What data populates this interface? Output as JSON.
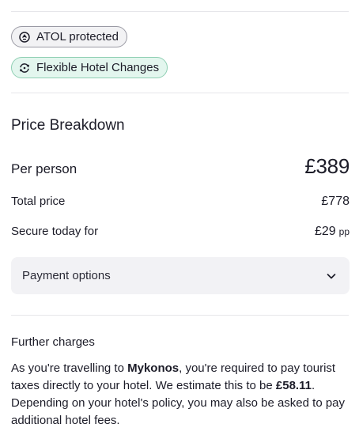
{
  "badges": {
    "atol": {
      "label": "ATOL protected",
      "icon": "atol-icon"
    },
    "flex": {
      "label": "Flexible Hotel Changes",
      "icon": "swap-icon"
    }
  },
  "price_breakdown": {
    "title": "Price Breakdown",
    "per_person_label": "Per person",
    "per_person_value": "£389",
    "total_label": "Total price",
    "total_value": "£778",
    "secure_label": "Secure today for",
    "secure_value": "£29",
    "secure_suffix": "pp"
  },
  "payment_options": {
    "label": "Payment options",
    "icon": "chevron-down-icon"
  },
  "further_charges": {
    "title": "Further charges",
    "text_1": "As you're travelling to ",
    "destination": "Mykonos",
    "text_2": ", you're required to pay tourist taxes directly to your hotel. We estimate this to be ",
    "amount": "£58.11",
    "text_3": ". Depending on your hotel's policy, you may also be asked to pay additional hotel fees."
  },
  "colors": {
    "atol_bg": "#f2f2f4",
    "flex_bg": "#e3f6ee",
    "flex_border": "#8fcfb3",
    "payment_bg": "#f2f2f5"
  }
}
